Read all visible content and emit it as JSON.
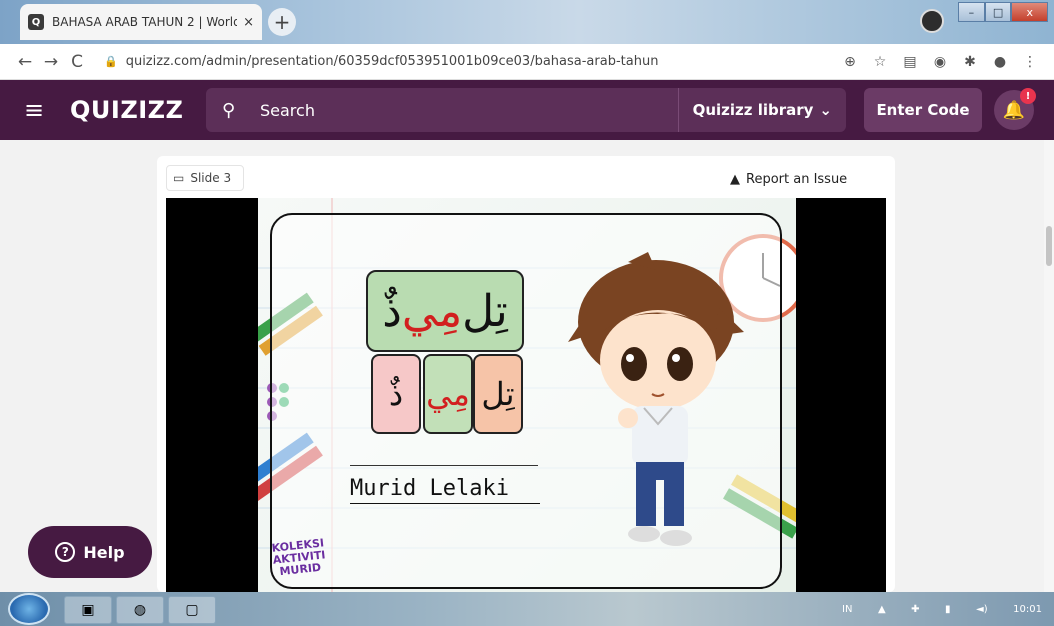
{
  "browser": {
    "tab_title": "BAHASA ARAB TAHUN 2 | World",
    "tab_close": "×",
    "new_tab": "+",
    "url": "quizizz.com/admin/presentation/60359dcf053951001b09ce03/bahasa-arab-tahun",
    "back": "←",
    "forward": "→",
    "reload": "C"
  },
  "header": {
    "logo": "QUIZIZZ",
    "search_placeholder": "Search",
    "library_label": "Quizizz library",
    "enter_code_label": "Enter Code",
    "notification_count": "!"
  },
  "slide": {
    "label": "Slide 3",
    "report_label": "Report an Issue",
    "word_part1": "تِل",
    "word_part2": "مِي",
    "word_part3": "ذٌ",
    "syllable_1": "ذٌ",
    "syllable_2": "مِي",
    "syllable_3": "تِل",
    "meaning": "Murid Lelaki",
    "brand_line1": "KOLEKSI",
    "brand_line2": "AKTIVITI",
    "brand_line3": "MURID"
  },
  "help": {
    "label": "Help",
    "icon_glyph": "?"
  },
  "taskbar": {
    "lang": "IN",
    "time": "10:01"
  }
}
